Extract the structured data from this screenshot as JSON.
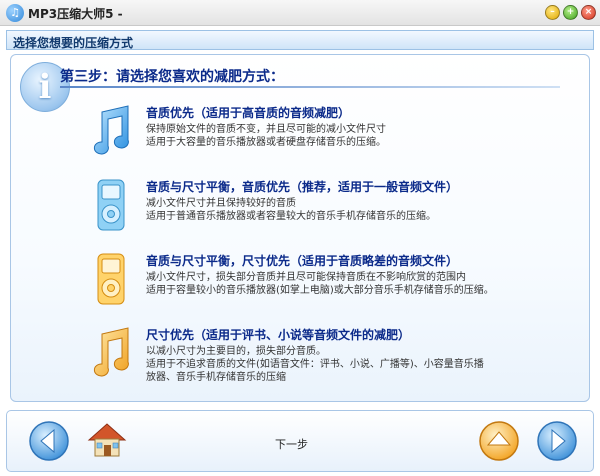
{
  "window": {
    "title": "MP3压缩大师5 -",
    "app_icon": "music-note-icon"
  },
  "panel": {
    "header": "选择您想要的压缩方式"
  },
  "step": {
    "title": "第三步：请选择您喜欢的减肥方式："
  },
  "options": [
    {
      "title": "音质优先（适用于高音质的音频减肥）",
      "desc1": "保持原始文件的音质不变，并且尽可能的减小文件尺寸",
      "desc2": "适用于大容量的音乐播放器或者硬盘存储音乐的压缩。",
      "icon": "music-note-blue-icon"
    },
    {
      "title": "音质与尺寸平衡，音质优先（推荐，适用于一般音频文件）",
      "desc1": "减小文件尺寸并且保持较好的音质",
      "desc2": "适用于普通音乐播放器或者容量较大的音乐手机存储音乐的压缩。",
      "icon": "mp3-player-blue-icon"
    },
    {
      "title": "音质与尺寸平衡，尺寸优先（适用于音质略差的音频文件）",
      "desc1": "减小文件尺寸，损失部分音质并且尽可能保持音质在不影响欣赏的范围内",
      "desc2": "适用于容量较小的音乐播放器(如掌上电脑)或大部分音乐手机存储音乐的压缩。",
      "icon": "mp3-player-orange-icon"
    },
    {
      "title": "尺寸优先（适用于评书、小说等音频文件的减肥）",
      "desc1": "以减小尺寸为主要目的，损失部分音质。",
      "desc2": "适用于不追求音质的文件(如语音文件：评书、小说、广播等)、小容量音乐播",
      "desc3": "放器、音乐手机存储音乐的压缩",
      "icon": "music-note-orange-icon"
    }
  ],
  "nav": {
    "next_label": "下一步",
    "back_icon": "arrow-left-icon",
    "home_icon": "home-icon",
    "up_icon": "arrow-up-icon",
    "forward_icon": "arrow-right-icon"
  }
}
